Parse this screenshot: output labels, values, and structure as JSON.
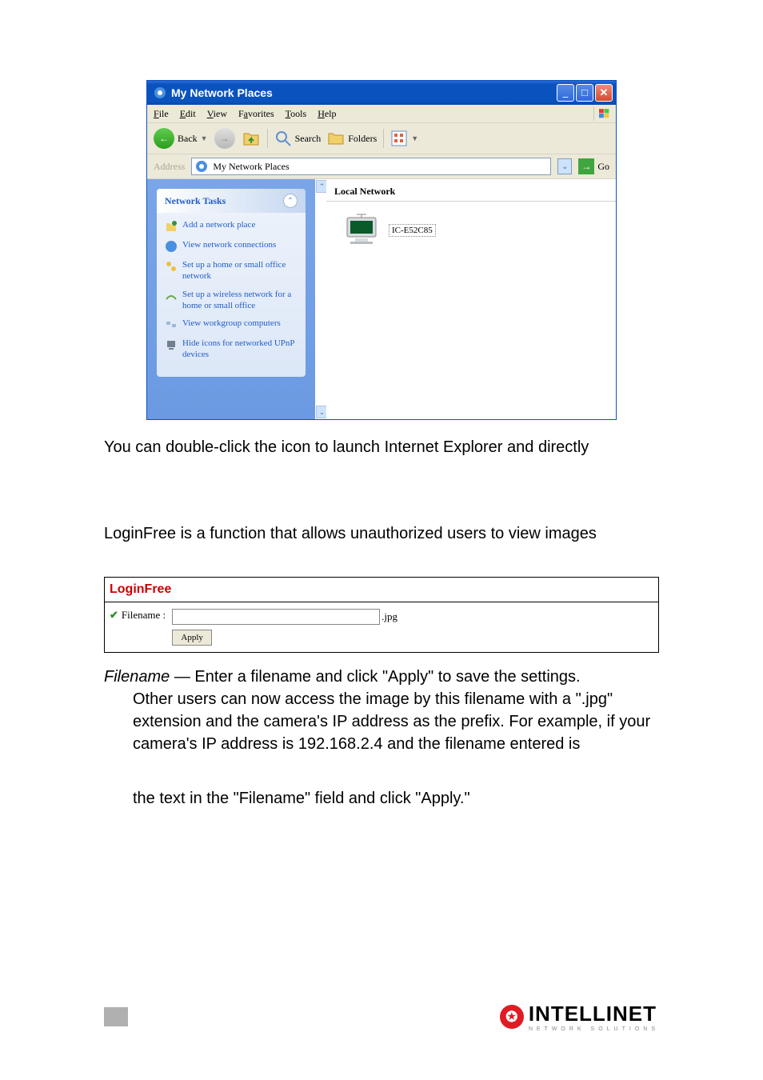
{
  "window": {
    "title": "My Network Places",
    "menus": {
      "file": "File",
      "edit": "Edit",
      "view": "View",
      "favorites": "Favorites",
      "tools": "Tools",
      "help": "Help"
    },
    "toolbar": {
      "back": "Back",
      "search": "Search",
      "folders": "Folders"
    },
    "address": {
      "label": "Address",
      "value": "My Network Places",
      "go": "Go"
    },
    "tasks": {
      "header": "Network Tasks",
      "items": [
        "Add a network place",
        "View network connections",
        "Set up a home or small office network",
        "Set up a wireless network for a home or small office",
        "View workgroup computers",
        "Hide icons for networked UPnP devices"
      ]
    },
    "main": {
      "group": "Local Network",
      "device": "IC-E52C85"
    }
  },
  "text1": "You can double-click the icon to launch Internet Explorer and directly",
  "text2": "LoginFree is a function that allows unauthorized users to view images",
  "loginfree": {
    "title": "LoginFree",
    "label": "Filename :",
    "ext": ".jpg",
    "apply": "Apply"
  },
  "desc": {
    "label": "Filename",
    "line1": " — Enter a filename and click \"Apply\" to save the settings.",
    "line2": "Other users can now access the image by this filename with a \".jpg\" extension and the camera's IP address as the prefix. For example, if your camera's IP address is 192.168.2.4 and the filename entered is",
    "line3": "the text in the \"Filename\" field and click \"Apply.\""
  },
  "footer": {
    "brand": "INTELLINET",
    "sub": "NETWORK SOLUTIONS"
  }
}
